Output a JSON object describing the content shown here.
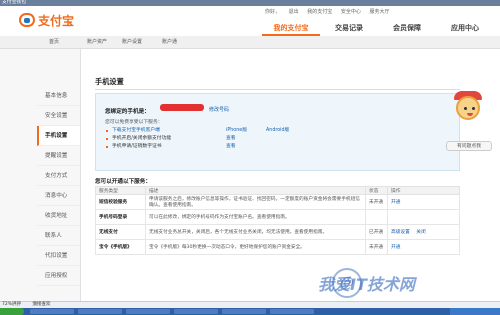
{
  "browser": {
    "top_items": [
      "支付宝钱包",
      "",
      "",
      "",
      "",
      ""
    ],
    "status_left": "72%評評",
    "status_text": "颁接查欢"
  },
  "header": {
    "logo": "支付宝",
    "user_links": [
      "你好，",
      "退出",
      "我的支付宝",
      "安全中心",
      "服务大厅"
    ],
    "tabs": [
      "我的支付宝",
      "交易记录",
      "会员保障",
      "应用中心"
    ]
  },
  "subnav": {
    "items": [
      "首页",
      "账户资产",
      "账户设置",
      "账户通"
    ]
  },
  "sidebar": {
    "items": [
      "基本信息",
      "安全设置",
      "手机设置",
      "提醒设置",
      "支付方式",
      "消息中心",
      "收货地址",
      "联系人",
      "代扣设置",
      "应用授权"
    ]
  },
  "main": {
    "title": "手机设置",
    "phone": {
      "label": "您绑定的手机是：",
      "change": "修改号码",
      "sub": "您可以免费享受以下服务：",
      "services": [
        {
          "text": "下载支付宝手机客户端",
          "c1": "iPhone版",
          "c2": "Android版"
        },
        {
          "text": "手机开启/关闭余额支付功能",
          "c1": "查看",
          "c2": ""
        },
        {
          "text": "手机申请/证销数字证书",
          "c1": "查看",
          "c2": ""
        }
      ]
    },
    "services_head": "您可以开通以下服务：",
    "table": {
      "headers": [
        "服务类型",
        "描述",
        "状态",
        "操作"
      ],
      "rows": [
        {
          "name": "短信校验服务",
          "desc": "申请该服务之后，修改账户信息等操作，证书验证、找回密码，一定额度的账户资金将会需要手机短信确认。查看使用指南。",
          "state": "未开通",
          "ops": [
            "开通"
          ]
        },
        {
          "name": "手机号码登录",
          "desc": "可以在此修改，绑定的手机号码作为支付宝账户名。查看使用指南。",
          "state": "",
          "ops": []
        },
        {
          "name": "无线支付",
          "desc": "无线支付业务总开关，关闭后，各个无线支付业务关闭，均无法使用。查看使用指南。",
          "state": "已开通",
          "ops": [
            "高级设置",
            "关闭"
          ]
        },
        {
          "name": "宝令《手机版》",
          "desc": "宝令《手机版》每30秒更换一次动态口令，更好地保护您的账户资金安全。",
          "state": "未开通",
          "ops": [
            "开通"
          ]
        }
      ]
    }
  },
  "robot": {
    "button": "有问题点我"
  },
  "watermark": "我爱IT技术网"
}
